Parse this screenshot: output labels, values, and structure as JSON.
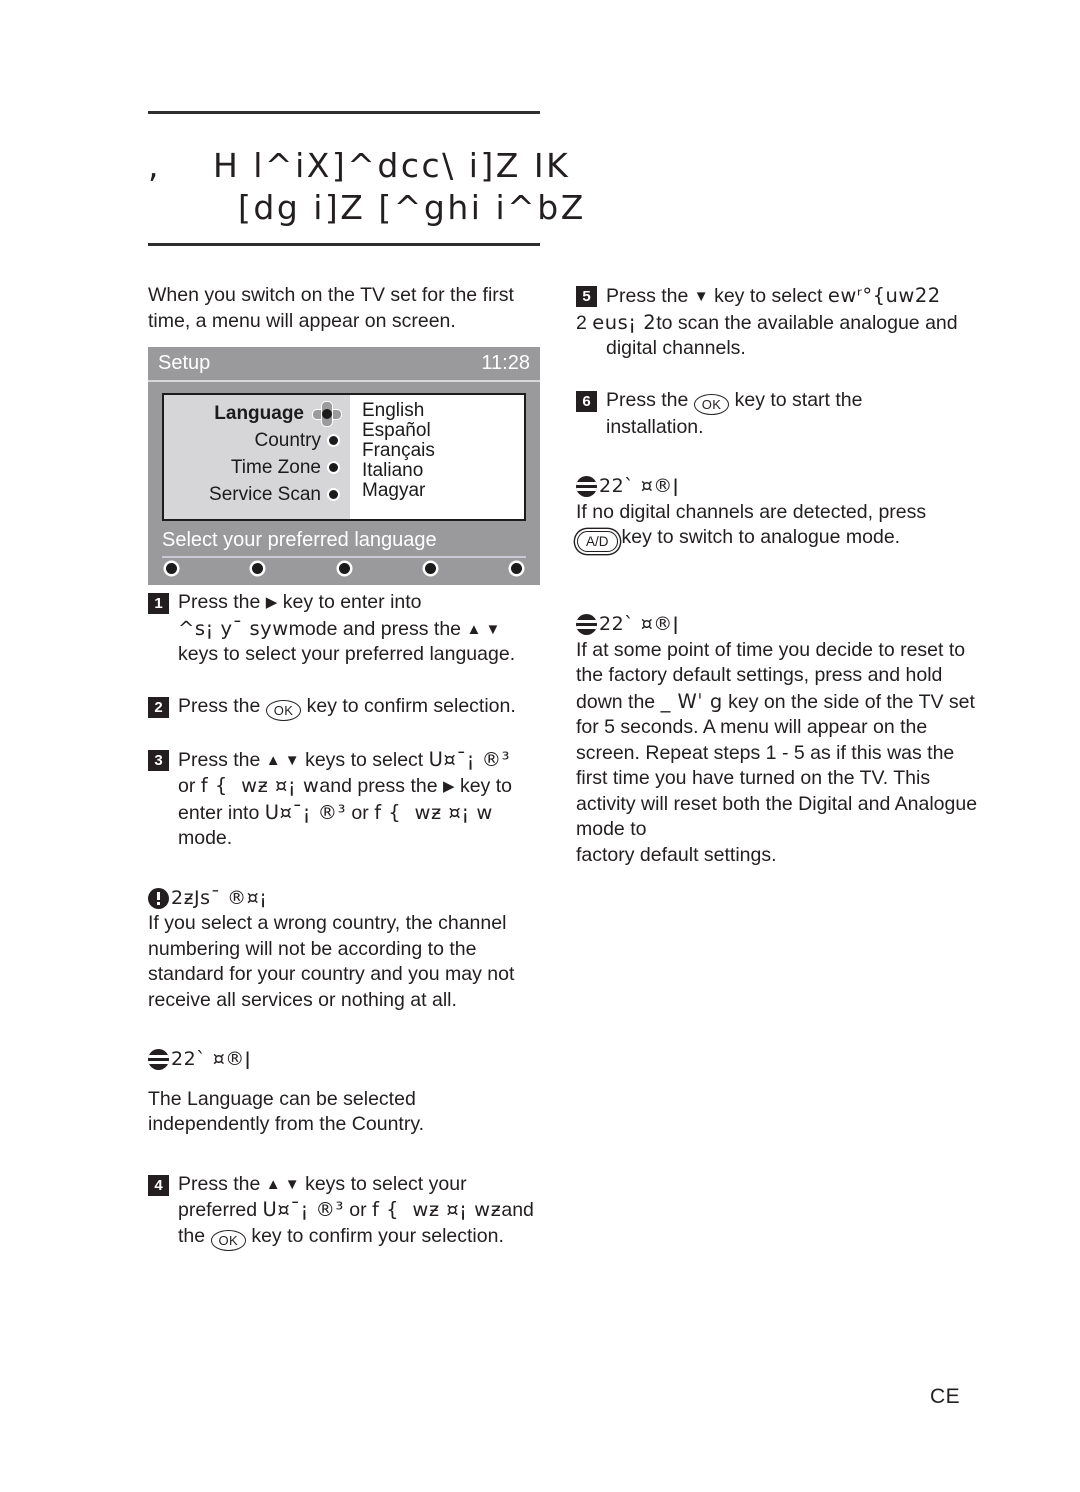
{
  "title": {
    "line1": ",    H l^iX]^dcc\\ i]Z IK",
    "line2": "[dg i]Z [^ghi i^bZ"
  },
  "left_column": {
    "intro": "When you switch on the TV set for the first time, a menu will appear on screen.",
    "tv_screen": {
      "menu_title": "Setup",
      "clock": "11:28",
      "items": [
        {
          "label": "Language",
          "active": true
        },
        {
          "label": "Country",
          "active": false
        },
        {
          "label": "Time Zone",
          "active": false
        },
        {
          "label": "Service Scan",
          "active": false
        }
      ],
      "languages": [
        "English",
        "Español",
        "Français",
        "Italiano",
        "Magyar"
      ],
      "caption": "Select your preferred language",
      "nav_dot_count": 5
    },
    "steps": [
      {
        "num": "1",
        "pre": "Press the ",
        "arrow": "▶",
        "mid1": " key to enter into",
        "enc1": "^s¡ y¯ syw",
        "mid2": "mode and press the ",
        "arrows2": "▲ ▼",
        "tail": "keys to select your preferred language."
      },
      {
        "num": "2",
        "pre": "Press the ",
        "key": "OK",
        "tail": "key to confirm selection."
      },
      {
        "num": "3",
        "pre": "Press the ",
        "arrows": "▲ ▼",
        "mid1": " keys to select ",
        "enc1": "U¤¯¡ ®³",
        "mid2": " or ",
        "enc2": "f {  wƶ ¤¡ w",
        "mid3": "and press the ",
        "arrow": "▶",
        "mid4": " key to",
        "mid5": "enter into ",
        "enc3": "U¤¯¡ ®³",
        "mid6": " or ",
        "enc4": "f {  wƶ ¤¡ w",
        "tail": "mode."
      },
      {
        "num": "4",
        "pre": "Press the ",
        "arrows": "▲ ▼",
        "mid1": " keys to select your",
        "mid2": "preferred ",
        "enc1": "U¤¯¡ ®³",
        "mid3": " or ",
        "enc2": "f {  wƶ ¤¡ wƶ",
        "mid4": "and",
        "mid5": "the ",
        "key": "OK",
        "tail": " key to confirm your selection."
      }
    ],
    "caution": {
      "icon": "caution-icon",
      "heading_enc": "2ƶJs¯ ®¤¡",
      "body": "If you select a wrong country, the channel numbering will not be according to the standard for your country and you may not receive all services or nothing at all."
    },
    "note": {
      "icon": "note-icon",
      "heading_enc": "22` ¤®ǀ",
      "body": "The Language can be selected independently from the Country."
    }
  },
  "right_column": {
    "steps": [
      {
        "num": "5",
        "pre": "Press the  ",
        "arrow": "▼",
        "mid1": "  key to select ",
        "enc1": "ewʳ°{uw22",
        "line2_pre": "2   ",
        "enc2": "eus¡ 2",
        "mid2": "to scan the available analogue and",
        "tail": "digital channels."
      },
      {
        "num": "6",
        "pre": "Press the ",
        "key": "OK",
        "mid1": " key to start the",
        "tail": "installation."
      }
    ],
    "note1": {
      "icon": "note-icon",
      "heading_enc": "22` ¤®ǀ",
      "body_pre": "If no digital channels are detected, press",
      "key": "A/D",
      "body_post": "key to switch to analogue mode."
    },
    "note2": {
      "icon": "note-icon",
      "heading_enc": "22` ¤®ǀ",
      "body_pre": "If at some point of time you decide to reset to the factory default settings, press and hold down the ",
      "enc_key": "_ Wˈ g",
      "body_post": " key on the side of the TV set for 5 seconds. A menu will appear on the screen. Repeat steps 1 - 5 as if this was the first time you have turned on the TV. This activity will reset both the Digital and Analogue mode to",
      "body_last": "factory default settings."
    }
  },
  "footer": {
    "page_mark": "CE"
  },
  "colors": {
    "text": "#231f20",
    "rule": "#2e2e2e",
    "tv_bg": "#9a9a9c",
    "tv_panel_left": "#d6d6d8",
    "tv_panel_right": "#ffffff"
  }
}
